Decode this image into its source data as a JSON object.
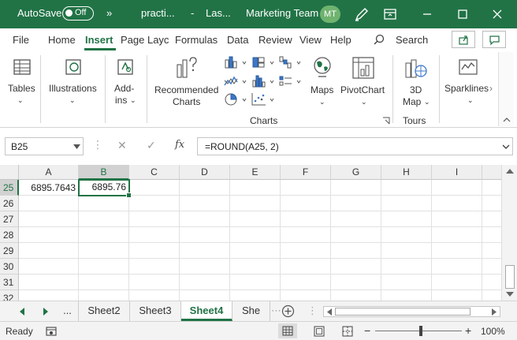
{
  "titlebar": {
    "autosave_label": "AutoSave",
    "autosave_state": "Off",
    "file_name": "practi...",
    "location": "Las...",
    "team": "Marketing Team",
    "user_initials": "MT",
    "more": "»"
  },
  "tabs": [
    "File",
    "Home",
    "Insert",
    "Page Layc",
    "Formulas",
    "Data",
    "Review",
    "View",
    "Help"
  ],
  "active_tab": "Insert",
  "search_label": "Search",
  "ribbon": {
    "tables": "Tables",
    "illustrations": "Illustrations",
    "addins_1": "Add-",
    "addins_2": "ins",
    "rec_charts_1": "Recommended",
    "rec_charts_2": "Charts",
    "maps": "Maps",
    "pivotchart": "PivotChart",
    "map3d_1": "3D",
    "map3d_2": "Map",
    "sparklines": "Sparklines",
    "group_charts": "Charts",
    "group_tours": "Tours"
  },
  "formula_bar": {
    "name_box": "B25",
    "cancel": "✕",
    "enter": "✓",
    "fx": "fx",
    "formula": "=ROUND(A25, 2)"
  },
  "grid": {
    "columns": [
      "A",
      "B",
      "C",
      "D",
      "E",
      "F",
      "G",
      "H",
      "I"
    ],
    "rows": [
      "25",
      "26",
      "27",
      "28",
      "29",
      "30",
      "31",
      "32"
    ],
    "a25": "6895.7643",
    "b25": "6895.76"
  },
  "sheets": {
    "ellipsis": "...",
    "tab1": "Sheet2",
    "tab2": "Sheet3",
    "tab3": "Sheet4",
    "tab4": "She"
  },
  "status": {
    "ready": "Ready",
    "zoom": "100%"
  },
  "colors": {
    "accent": "#217346",
    "chrome": "#f3f3f3"
  }
}
